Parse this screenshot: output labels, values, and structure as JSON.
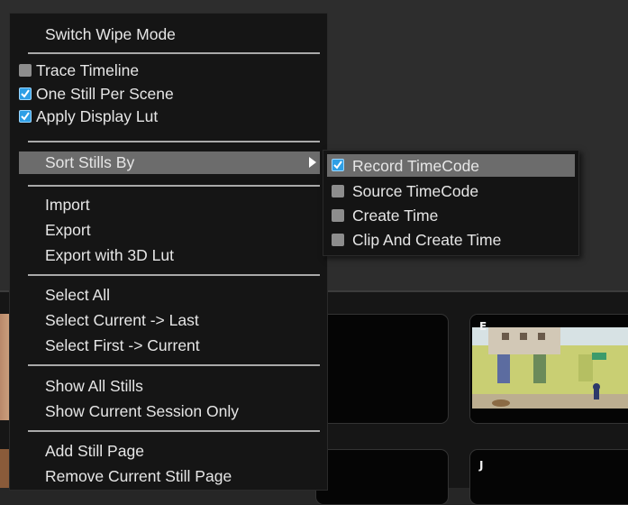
{
  "menu": {
    "switch_wipe": "Switch Wipe Mode",
    "toggles": [
      {
        "label": "Trace Timeline",
        "checked": false
      },
      {
        "label": "One Still Per Scene",
        "checked": true
      },
      {
        "label": "Apply Display Lut",
        "checked": true
      }
    ],
    "sort_stills": "Sort Stills By",
    "file_items": [
      "Import",
      "Export",
      "Export with 3D Lut"
    ],
    "select_items": [
      "Select All",
      "Select Current -> Last",
      "Select First -> Current"
    ],
    "show_items": [
      "Show All Stills",
      "Show Current Session Only"
    ],
    "page_items": [
      "Add Still Page",
      "Remove Current Still Page"
    ]
  },
  "submenu": {
    "options": [
      {
        "label": "Record TimeCode",
        "checked": true
      },
      {
        "label": "Source TimeCode",
        "checked": false
      },
      {
        "label": "Create Time",
        "checked": false
      },
      {
        "label": "Clip And Create Time",
        "checked": false
      }
    ]
  },
  "gallery": {
    "thumb_labels": [
      "E",
      "J"
    ]
  },
  "colors": {
    "menu_bg": "#151515",
    "highlight": "#6c6c6c",
    "checkbox_on": "#2e9fe6",
    "checkbox_off": "#8d8d8d",
    "text": "#e6e6e6"
  },
  "icons": {
    "submenu_arrow": "triangle-right-icon",
    "checked": "checkbox-checked-icon",
    "unchecked": "checkbox-unchecked-icon"
  }
}
